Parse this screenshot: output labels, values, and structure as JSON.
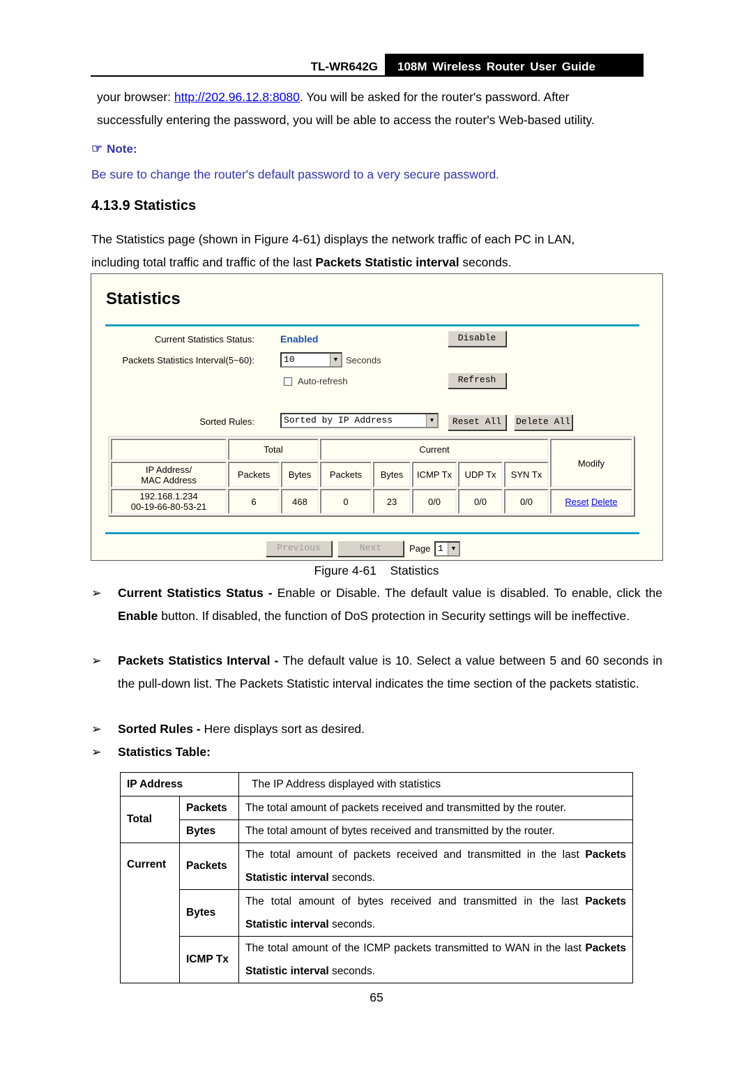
{
  "header": {
    "model": "TL-WR642G",
    "guide_title": "108M Wireless Router User Guide"
  },
  "intro": {
    "line1_before": "your browser: ",
    "url": "http://202.96.12.8:8080",
    "line1_after": ". You will be asked for the router's password. After",
    "line2": "successfully entering the password, you will be able to access the router's Web-based utility."
  },
  "note": {
    "title": "Note:",
    "text": "Be sure to change the router's default password to a very secure password.",
    "color": "#3333aa"
  },
  "section": {
    "heading": "4.13.9 Statistics",
    "p1": "The Statistics page (shown in Figure 4-61) displays the network traffic of each PC in LAN,",
    "p2_before": "including total traffic and traffic of the last ",
    "p2_bold": "Packets Statistic interval",
    "p2_after": " seconds."
  },
  "figure": {
    "title": "Statistics",
    "accent_color": "#1a9dc4",
    "status_label": "Current Statistics Status:",
    "status_value": "Enabled",
    "status_color": "#1f4fa8",
    "disable_button": "Disable",
    "interval_label": "Packets Statistics Interval(5~60):",
    "interval_value": "10",
    "interval_unit": "Seconds",
    "auto_refresh_label": "Auto-refresh",
    "auto_refresh_checked": false,
    "refresh_button": "Refresh",
    "sorted_label": "Sorted Rules:",
    "sorted_value": "Sorted by IP Address",
    "reset_all_button": "Reset All",
    "delete_all_button": "Delete All",
    "table": {
      "group_total": "Total",
      "group_current": "Current",
      "col_ip": "IP Address/",
      "col_mac": "MAC Address",
      "col_modify": "Modify",
      "columns": [
        "Packets",
        "Bytes",
        "Packets",
        "Bytes",
        "ICMP Tx",
        "UDP Tx",
        "SYN Tx"
      ],
      "rows": [
        {
          "ip": "192.168.1.234",
          "mac": "00-19-66-80-53-21",
          "values": [
            "6",
            "468",
            "0",
            "23",
            "0/0",
            "0/0",
            "0/0"
          ],
          "reset_link": "Reset",
          "delete_link": "Delete"
        }
      ]
    },
    "previous_button": "Previous",
    "next_button": "Next",
    "page_label": "Page",
    "page_value": "1"
  },
  "caption": "Figure 4-61    Statistics",
  "bullets": [
    {
      "bold": "Current Statistics Status - ",
      "text": "Enable or Disable. The default value is disabled. To enable, click the ",
      "bold2": "Enable",
      "text2": " button. If disabled, the function of DoS protection in Security settings will be ineffective."
    },
    {
      "bold": "Packets Statistics Interval - ",
      "text": "The default value is 10. Select a value between 5 and 60 seconds in the pull-down list. The Packets Statistic interval indicates the time section of the packets statistic."
    },
    {
      "bold": "Sorted Rules - ",
      "text": "Here displays sort as desired."
    },
    {
      "bold": "Statistics Table:",
      "text": ""
    }
  ],
  "desc_table": {
    "ip_label": "IP Address",
    "ip_desc": "The IP Address displayed with statistics",
    "total_label": "Total",
    "total_packets_label": "Packets",
    "total_packets_desc": "The total amount of packets received and transmitted by the router.",
    "total_bytes_label": "Bytes",
    "total_bytes_desc": "The total amount of bytes received and transmitted by the router.",
    "current_label": "Current",
    "cur_packets_label": "Packets",
    "cur_packets_desc": "The total amount of packets received and transmitted in the last ",
    "cur_bytes_label": "Bytes",
    "cur_bytes_desc": "The total amount of bytes received and transmitted in the last ",
    "icmp_label": "ICMP Tx",
    "icmp_desc": "The total amount of the ICMP packets transmitted to WAN in the last ",
    "bold_term": "Packets Statistic interval",
    "suffix": " seconds."
  },
  "page_number": "65"
}
